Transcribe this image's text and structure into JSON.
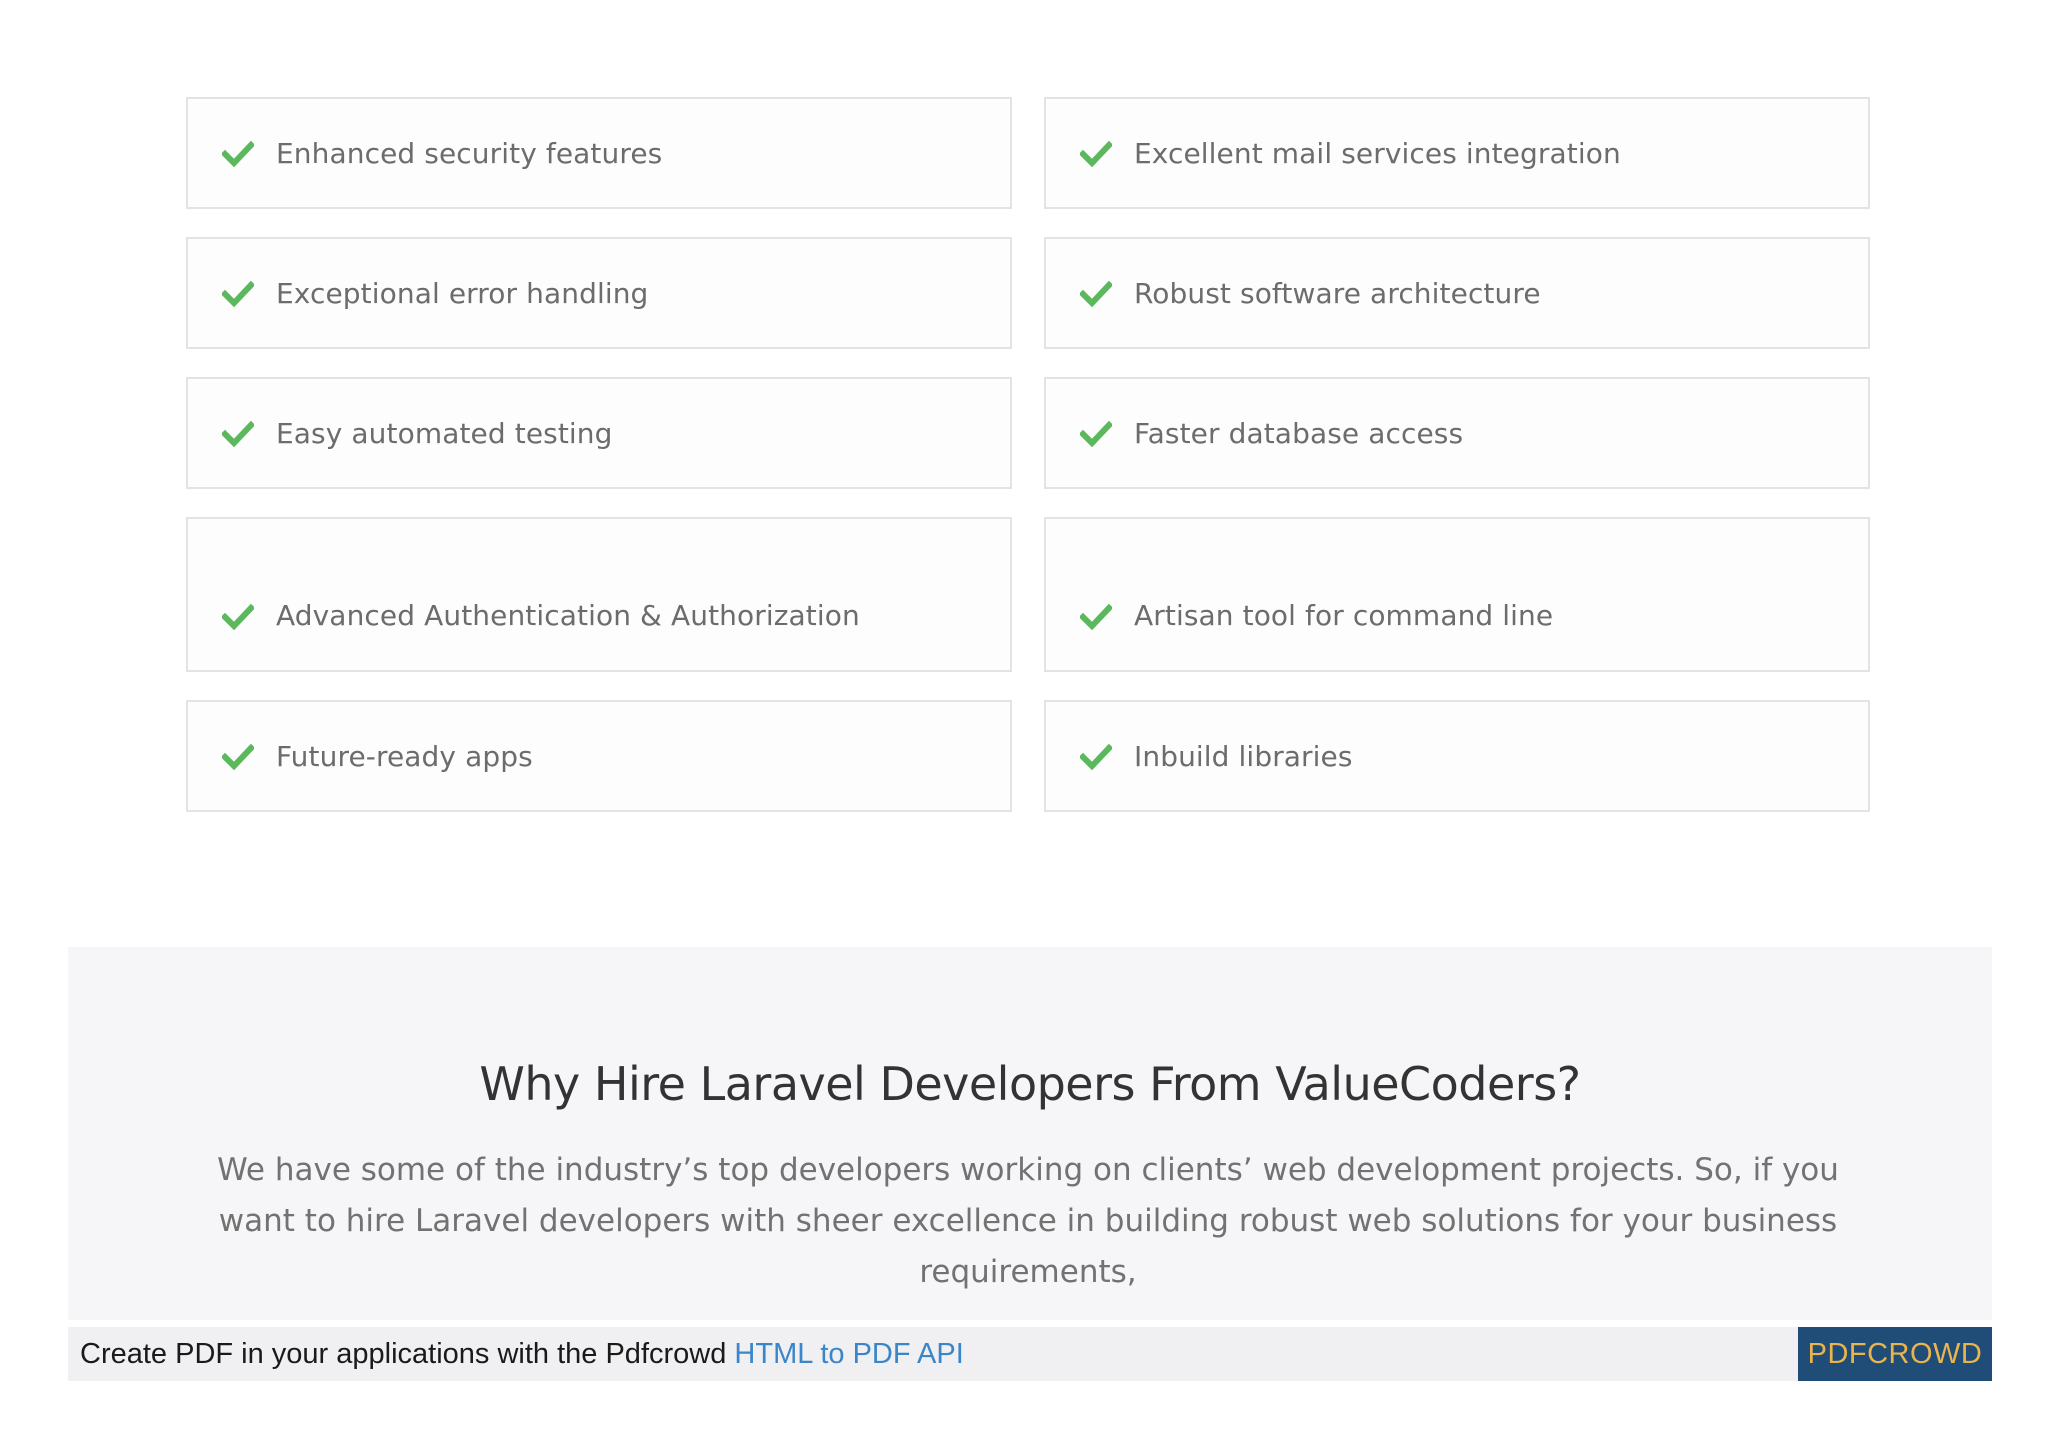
{
  "features": {
    "items": [
      {
        "label": "Enhanced security features",
        "icon": "check-icon"
      },
      {
        "label": "Excellent mail services integration",
        "icon": "check-icon"
      },
      {
        "label": "Exceptional error handling",
        "icon": "check-icon"
      },
      {
        "label": "Robust software architecture",
        "icon": "check-icon"
      },
      {
        "label": "Easy automated testing",
        "icon": "check-icon"
      },
      {
        "label": "Faster database access",
        "icon": "check-icon"
      },
      {
        "label": "Advanced Authentication & Authorization",
        "icon": "check-icon"
      },
      {
        "label": "Artisan tool for command line",
        "icon": "check-icon"
      },
      {
        "label": "Future-ready apps",
        "icon": "check-icon"
      },
      {
        "label": "Inbuild libraries",
        "icon": "check-icon"
      }
    ],
    "check_color": "#5cb85c"
  },
  "why_section": {
    "title": "Why Hire Laravel Developers From ValueCoders?",
    "description": "We have some of the industry’s top developers working on clients’ web development projects. So, if you want to hire Laravel developers with sheer excellence in building robust web solutions for your business requirements,"
  },
  "pdf_banner": {
    "text": "Create PDF in your applications with the Pdfcrowd ",
    "link_text": "HTML to PDF API",
    "badge": "PDFCROWD",
    "badge_bg": "#1f4d78",
    "badge_color": "#e9b44c",
    "link_color": "#3a86c8"
  }
}
